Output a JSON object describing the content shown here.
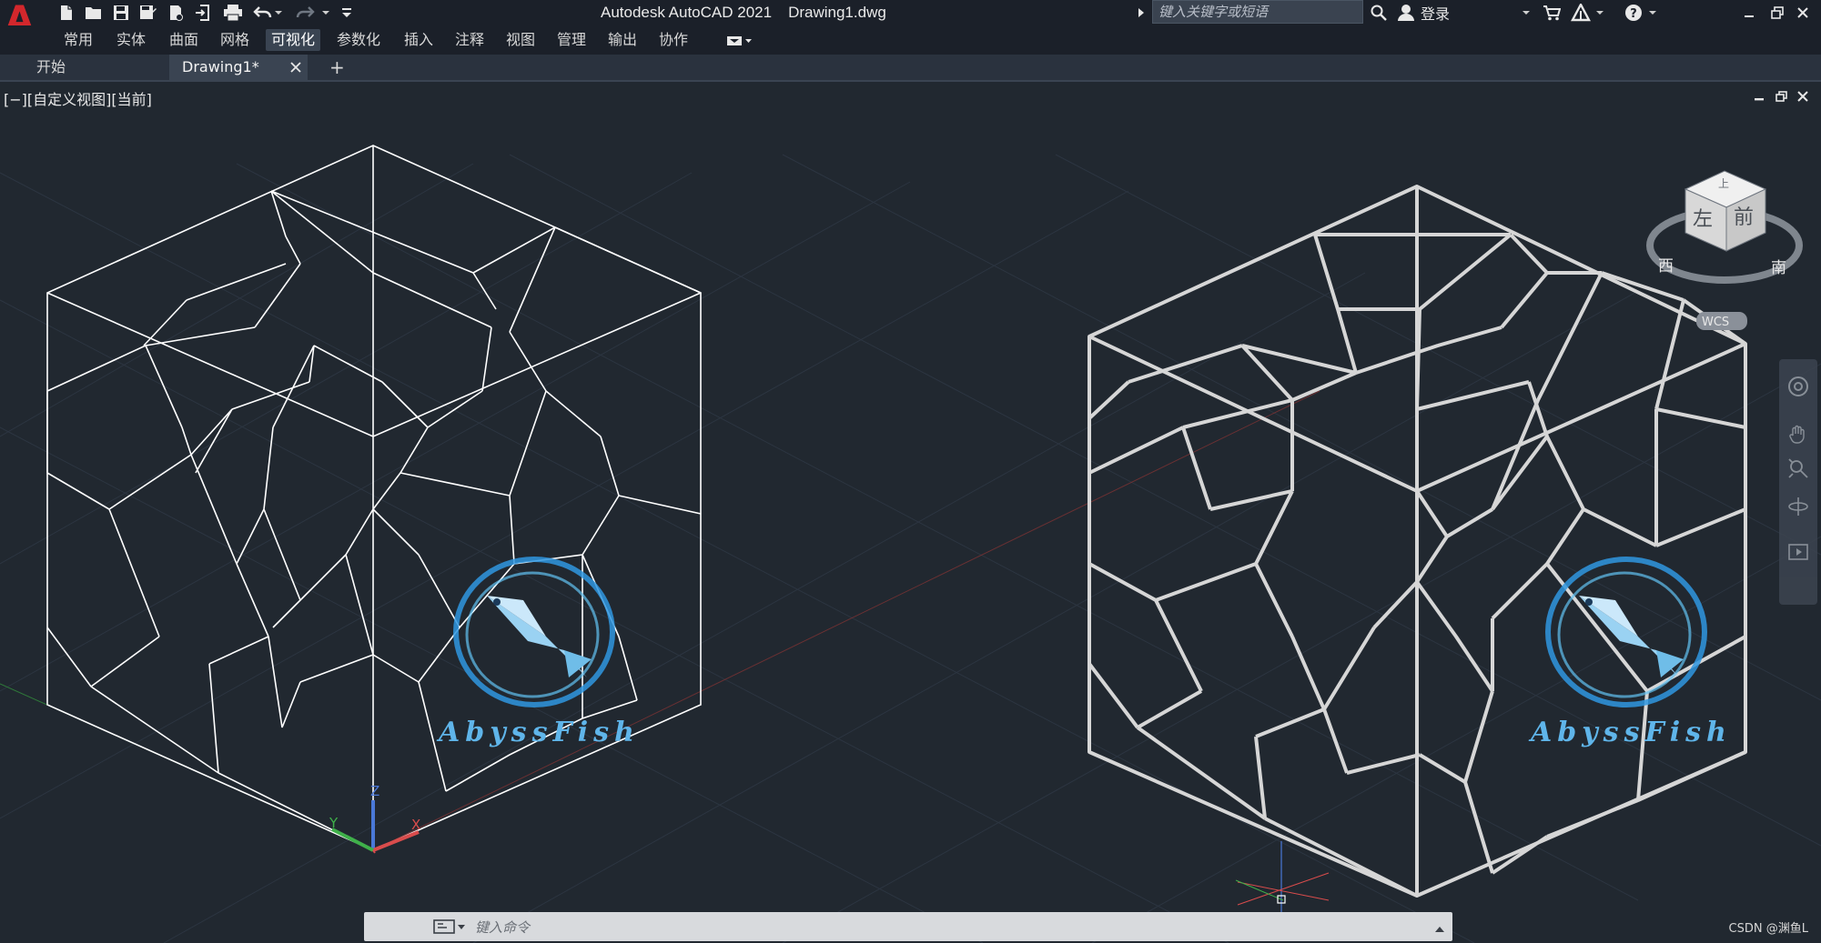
{
  "app": {
    "title_app": "Autodesk AutoCAD 2021",
    "title_file": "Drawing1.dwg",
    "logo_letter": "A",
    "logo_color": "#d3272c"
  },
  "search": {
    "placeholder": "键入关键字或短语"
  },
  "header": {
    "login_label": "登录"
  },
  "ribbon": {
    "tabs": [
      {
        "label": "常用"
      },
      {
        "label": "实体"
      },
      {
        "label": "曲面"
      },
      {
        "label": "网格"
      },
      {
        "label": "可视化"
      },
      {
        "label": "参数化"
      },
      {
        "label": "插入"
      },
      {
        "label": "注释"
      },
      {
        "label": "视图"
      },
      {
        "label": "管理"
      },
      {
        "label": "输出"
      },
      {
        "label": "协作"
      }
    ],
    "active": "可视化"
  },
  "doc_tabs": {
    "start_label": "开始",
    "drawing_label": "Drawing1*",
    "add_label": "+"
  },
  "viewport": {
    "label": "[−][自定义视图][当前]",
    "viewcube_left": "左",
    "viewcube_front": "前",
    "viewcube_top": "上",
    "compass_west": "西",
    "compass_south": "南",
    "wcs_label": "WCS",
    "axis_x": "X",
    "axis_y": "Y",
    "axis_z": "Z"
  },
  "watermark": {
    "text": "AbyssFish"
  },
  "command": {
    "placeholder": "键入命令"
  },
  "credit": "CSDN @渊鱼L",
  "colors": {
    "background": "#212830",
    "wire_thin": "#ffffff",
    "wire_thick": "#d6d6d6",
    "axis_x": "#d94c4c",
    "axis_y": "#3fb04a",
    "axis_z": "#4a78d8",
    "watermark": "#5fb5ea"
  }
}
